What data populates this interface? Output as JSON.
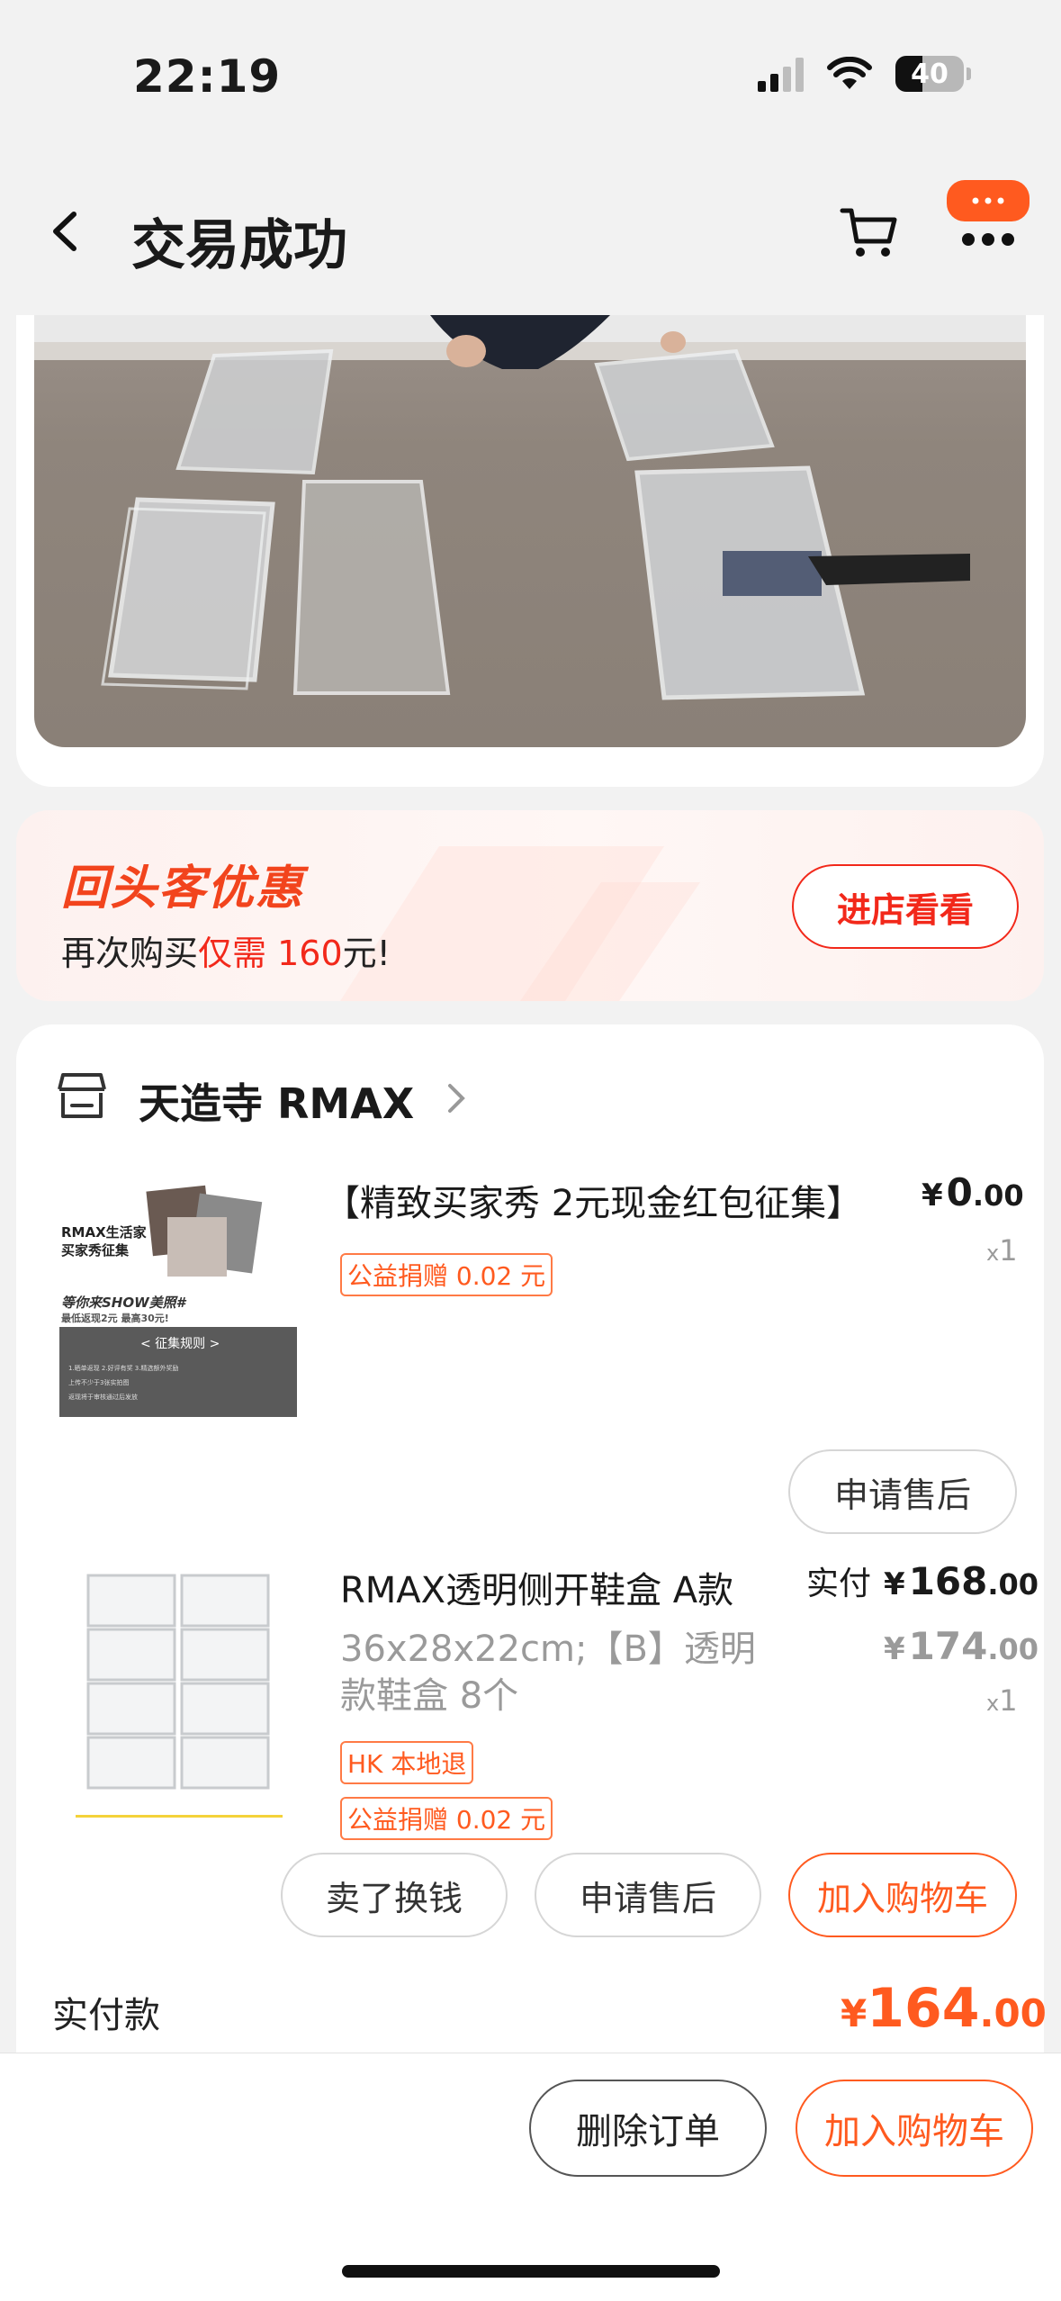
{
  "status_bar": {
    "time": "22:19",
    "battery": "40"
  },
  "nav": {
    "title": "交易成功"
  },
  "promo": {
    "title": "回头客优惠",
    "subtitle_prefix": "再次购买",
    "subtitle_highlight": "仅需 160",
    "subtitle_suffix": "元!",
    "button": "进店看看"
  },
  "shop": {
    "name": "天造寺 RMAX"
  },
  "items": [
    {
      "title": "【精致买家秀 2元现金红包征集】",
      "price_int": "0",
      "price_dec": ".00",
      "qty": "1",
      "tags": [
        "公益捐赠 0.02 元"
      ],
      "action": "申请售后"
    },
    {
      "title": "RMAX透明侧开鞋盒 A款",
      "spec": "36x28x22cm;【B】透明款鞋盒 8个",
      "paid_label": "实付",
      "paid_int": "168",
      "paid_dec": ".00",
      "orig_int": "174",
      "orig_dec": ".00",
      "qty": "1",
      "tags": [
        "HK 本地退",
        "公益捐赠 0.02 元"
      ],
      "actions": [
        "卖了换钱",
        "申请售后",
        "加入购物车"
      ]
    }
  ],
  "thumb1": {
    "line1": "RMAX生活家",
    "line2": "买家秀征集",
    "line3": "等你来SHOW美照#",
    "line4": "最低返现2元 最高30元!",
    "rules": "< 征集规则 >"
  },
  "summary": {
    "label": "实付款",
    "amount_int": "164",
    "amount_dec": ".00"
  },
  "currency": "¥",
  "qty_prefix": "x",
  "bottom": {
    "delete": "删除订单",
    "add_cart": "加入购物车"
  },
  "colors": {
    "accent": "#ff5a1f",
    "red": "#f2281a",
    "background": "#f2f2f2"
  }
}
